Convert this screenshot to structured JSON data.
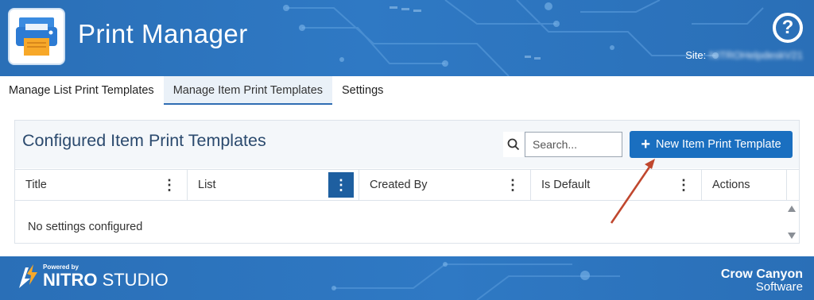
{
  "header": {
    "app_title": "Print Manager",
    "help_label": "?",
    "site_label": "Site:",
    "site_value": "NITROHelpdeskV21"
  },
  "tabs": [
    {
      "label": "Manage List Print Templates",
      "active": false
    },
    {
      "label": "Manage Item Print Templates",
      "active": true
    },
    {
      "label": "Settings",
      "active": false
    }
  ],
  "panel": {
    "title": "Configured Item Print Templates",
    "search_placeholder": "Search...",
    "new_button_label": "New Item Print Template",
    "columns": [
      "Title",
      "List",
      "Created By",
      "Is Default",
      "Actions"
    ],
    "empty_message": "No settings configured"
  },
  "footer": {
    "powered_by": "Powered by",
    "studio_bold": "NITRO",
    "studio_rest": " STUDIO",
    "company_line1": "Crow Canyon",
    "company_line2": "Software"
  },
  "colors": {
    "header_blue": "#2f79c4",
    "button_blue": "#1a6fc0",
    "active_menu_blue": "#1e5fa0",
    "annotation_arrow": "#c0472e"
  },
  "icons": [
    "printer-icon",
    "help-icon",
    "search-icon",
    "plus-icon",
    "column-menu-icon",
    "scroll-up-icon",
    "scroll-down-icon",
    "nitro-bolt-icon"
  ]
}
